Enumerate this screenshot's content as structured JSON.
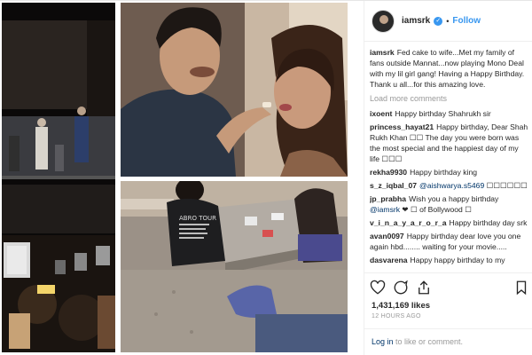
{
  "post": {
    "username": "iamsrk",
    "verified_glyph": "✓",
    "separator": "•",
    "follow_label": "Follow",
    "caption_user": "iamsrk",
    "caption": "Fed cake to wife...Met my family of fans outside Mannat...now playing Mono Deal with my lil girl gang! Having a Happy Birthday. Thank u all...for this amazing love.",
    "load_more": "Load more comments",
    "likes": "1,431,169 likes",
    "time": "12 HOURS AGO",
    "login_link": "Log in",
    "login_rest": " to like or comment."
  },
  "comments": [
    {
      "user": "ixoent",
      "pre": "Happy birthday Shahrukh sir",
      "mention": "",
      "post": ""
    },
    {
      "user": "princess_hayat21",
      "pre": "Happy birthday, Dear Shah Rukh Khan ☐☐ The day you were born was the most special and the happiest day of my life ☐☐☐",
      "mention": "",
      "post": ""
    },
    {
      "user": "rekha9930",
      "pre": "Happy birthday king",
      "mention": "",
      "post": ""
    },
    {
      "user": "s_z_iqbal_07",
      "pre": "",
      "mention": "@aishwarya.s5469",
      "post": " ☐☐☐☐☐☐"
    },
    {
      "user": "jp_prabha",
      "pre": "Wish you a happy birthday ",
      "mention": "@iamsrk",
      "post": " ❤ ☐ of Bollywood ☐"
    },
    {
      "user": "v_i_n_a_y_a_r_o_r_a",
      "pre": "Happy birthday day srk",
      "mention": "",
      "post": ""
    },
    {
      "user": "avan0097",
      "pre": "Happy birthday dear love you one again hbd........ waiting for your movie.....",
      "mention": "",
      "post": ""
    },
    {
      "user": "dasvarena",
      "pre": "Happy happy birthday to my",
      "mention": "",
      "post": ""
    }
  ],
  "icons": [
    "heart-icon",
    "comment-icon",
    "share-icon",
    "bookmark-icon"
  ],
  "colors": {
    "accent": "#3897f0",
    "mention": "#003569",
    "muted": "#999999"
  },
  "photo_text": {
    "tshirt": "ABRO TOUR"
  }
}
